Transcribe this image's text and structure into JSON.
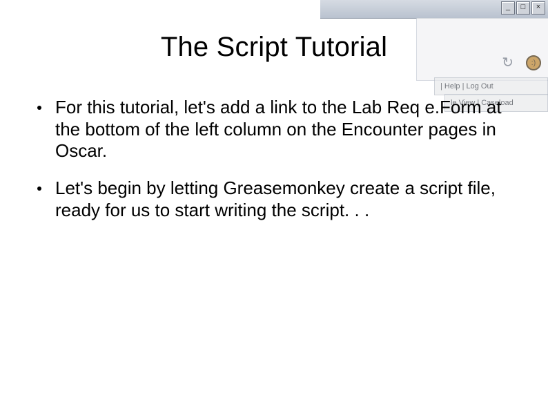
{
  "slide": {
    "title": "The Script Tutorial",
    "bullets": [
      "For this tutorial, let's add a link to the Lab Req e.Form at the bottom of the left column on the Encounter pages in Oscar.",
      "Let's begin by letting Greasemonkey create a script file, ready for us to start writing the script. . ."
    ]
  },
  "window_controls": {
    "minimize": "_",
    "maximize": "□",
    "close": "×"
  },
  "toolbar": {
    "reload_glyph": "↻",
    "monkey_face": ":)"
  },
  "background_tabs": {
    "fragment": "le View | Caseload",
    "links": "| Help | Log Out"
  }
}
